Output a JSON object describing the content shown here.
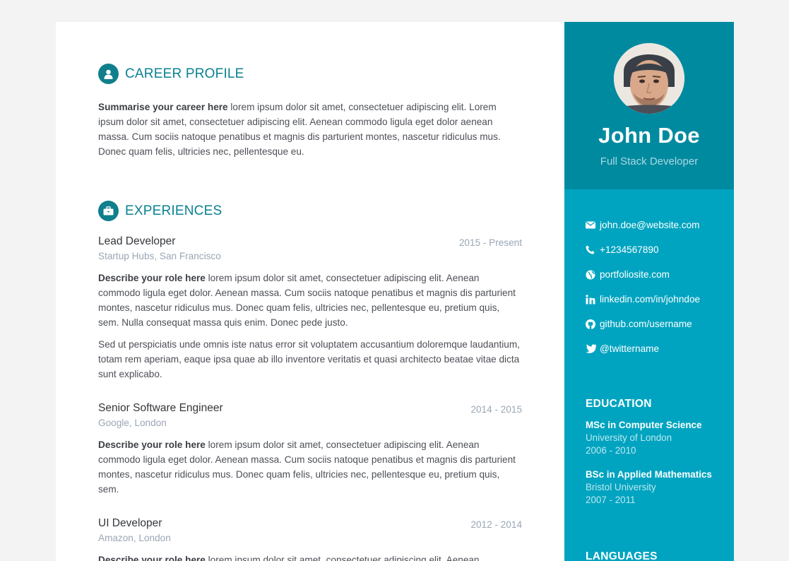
{
  "colors": {
    "accent": "#0f7f8c",
    "sidebar": "#00a4c0",
    "sidebar_header": "#008aa0"
  },
  "career": {
    "title": "CAREER PROFILE",
    "icon": "user-icon",
    "lead": "Summarise your career here",
    "text": " lorem ipsum dolor sit amet, consectetuer adipiscing elit. Lorem ipsum dolor sit amet, consectetuer adipiscing elit. Aenean commodo ligula eget dolor aenean massa. Cum sociis natoque penatibus et magnis dis parturient montes, nascetur ridiculus mus. Donec quam felis, ultricies nec, pellentesque eu."
  },
  "experiences": {
    "title": "EXPERIENCES",
    "icon": "briefcase-icon",
    "jobs": [
      {
        "title": "Lead Developer",
        "time": "2015 - Present",
        "company": "Startup Hubs, San Francisco",
        "lead": "Describe your role here",
        "text": " lorem ipsum dolor sit amet, consectetuer adipiscing elit. Aenean commodo ligula eget dolor. Aenean massa. Cum sociis natoque penatibus et magnis dis parturient montes, nascetur ridiculus mus. Donec quam felis, ultricies nec, pellentesque eu, pretium quis, sem. Nulla consequat massa quis enim. Donec pede justo.",
        "extra": "Sed ut perspiciatis unde omnis iste natus error sit voluptatem accusantium doloremque laudantium, totam rem aperiam, eaque ipsa quae ab illo inventore veritatis et quasi architecto beatae vitae dicta sunt explicabo."
      },
      {
        "title": "Senior Software Engineer",
        "time": "2014 - 2015",
        "company": "Google, London",
        "lead": "Describe your role here",
        "text": " lorem ipsum dolor sit amet, consectetuer adipiscing elit. Aenean commodo ligula eget dolor. Aenean massa. Cum sociis natoque penatibus et magnis dis parturient montes, nascetur ridiculus mus. Donec quam felis, ultricies nec, pellentesque eu, pretium quis, sem."
      },
      {
        "title": "UI Developer",
        "time": "2012 - 2014",
        "company": "Amazon, London",
        "lead": "Describe your role here",
        "text": " lorem ipsum dolor sit amet, consectetuer adipiscing elit. Aenean"
      }
    ]
  },
  "profile": {
    "name": "John Doe",
    "tagline": "Full Stack Developer",
    "avatar_icon": "profile-photo"
  },
  "contact": [
    {
      "icon": "envelope-icon",
      "text": "john.doe@website.com"
    },
    {
      "icon": "phone-icon",
      "text": "+1234567890"
    },
    {
      "icon": "globe-icon",
      "text": "portfoliosite.com"
    },
    {
      "icon": "linkedin-icon",
      "text": "linkedin.com/in/johndoe"
    },
    {
      "icon": "github-icon",
      "text": "github.com/username"
    },
    {
      "icon": "twitter-icon",
      "text": "@twittername"
    }
  ],
  "education": {
    "title": "EDUCATION",
    "items": [
      {
        "degree": "MSc in Computer Science",
        "school": "University of London",
        "years": "2006 - 2010"
      },
      {
        "degree": "BSc in Applied Mathematics",
        "school": "Bristol University",
        "years": "2007 - 2011"
      }
    ]
  },
  "languages": {
    "title": "LANGUAGES"
  }
}
